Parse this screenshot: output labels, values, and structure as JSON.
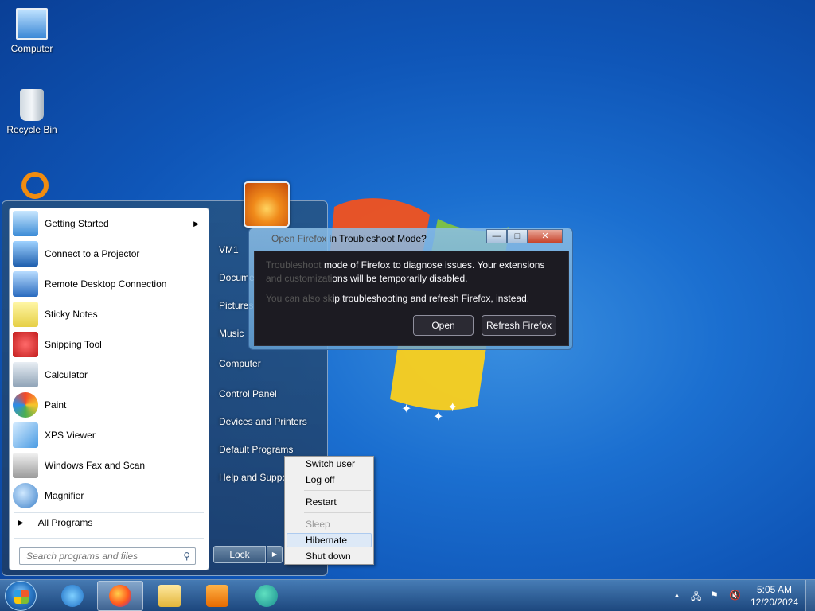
{
  "desktop": {
    "icons": [
      {
        "label": "Computer"
      },
      {
        "label": "Recycle Bin"
      }
    ]
  },
  "start_menu": {
    "programs": [
      {
        "label": "Getting Started",
        "has_submenu": true
      },
      {
        "label": "Connect to a Projector"
      },
      {
        "label": "Remote Desktop Connection"
      },
      {
        "label": "Sticky Notes"
      },
      {
        "label": "Snipping Tool"
      },
      {
        "label": "Calculator"
      },
      {
        "label": "Paint"
      },
      {
        "label": "XPS Viewer"
      },
      {
        "label": "Windows Fax and Scan"
      },
      {
        "label": "Magnifier"
      }
    ],
    "all_programs": "All Programs",
    "search_placeholder": "Search programs and files",
    "right_links": [
      "VM1",
      "Documents",
      "Pictures",
      "Music",
      "Computer",
      "Control Panel",
      "Devices and Printers",
      "Default Programs",
      "Help and Support"
    ],
    "lock_label": "Lock"
  },
  "power_menu": {
    "items": [
      {
        "label": "Switch user",
        "disabled": false
      },
      {
        "label": "Log off",
        "disabled": false
      },
      {
        "label": "Restart",
        "disabled": false
      },
      {
        "label": "Sleep",
        "disabled": true
      },
      {
        "label": "Hibernate",
        "disabled": false,
        "highlighted": true
      },
      {
        "label": "Shut down",
        "disabled": false
      }
    ]
  },
  "firefox_dialog": {
    "title_hidden": "Open Firefox i",
    "title_visible": "n Troubleshoot Mode?",
    "line1_hidden": "Troubleshoot ",
    "line1_visible": "mode of Firefox to diagnose issues. Your extensions",
    "line2_hidden": "and customizati",
    "line2_visible": "ons will be temporarily disabled.",
    "line3_hidden": "You can also sk",
    "line3_visible": "ip troubleshooting and refresh Firefox, instead.",
    "open_label": "Open",
    "refresh_label": "Refresh Firefox",
    "min_glyph": "—",
    "max_glyph": "□",
    "close_glyph": "✕"
  },
  "taskbar": {
    "apps": [
      "internet-explorer",
      "firefox",
      "file-explorer",
      "media-player",
      "edge"
    ],
    "active_app": "firefox",
    "clock_time": "5:05 AM",
    "clock_date": "12/20/2024"
  },
  "colors": {
    "desktop_blue": "#1b6fd0",
    "firefox_dark": "#1c1b22",
    "power_highlight": "#dde9f7"
  }
}
